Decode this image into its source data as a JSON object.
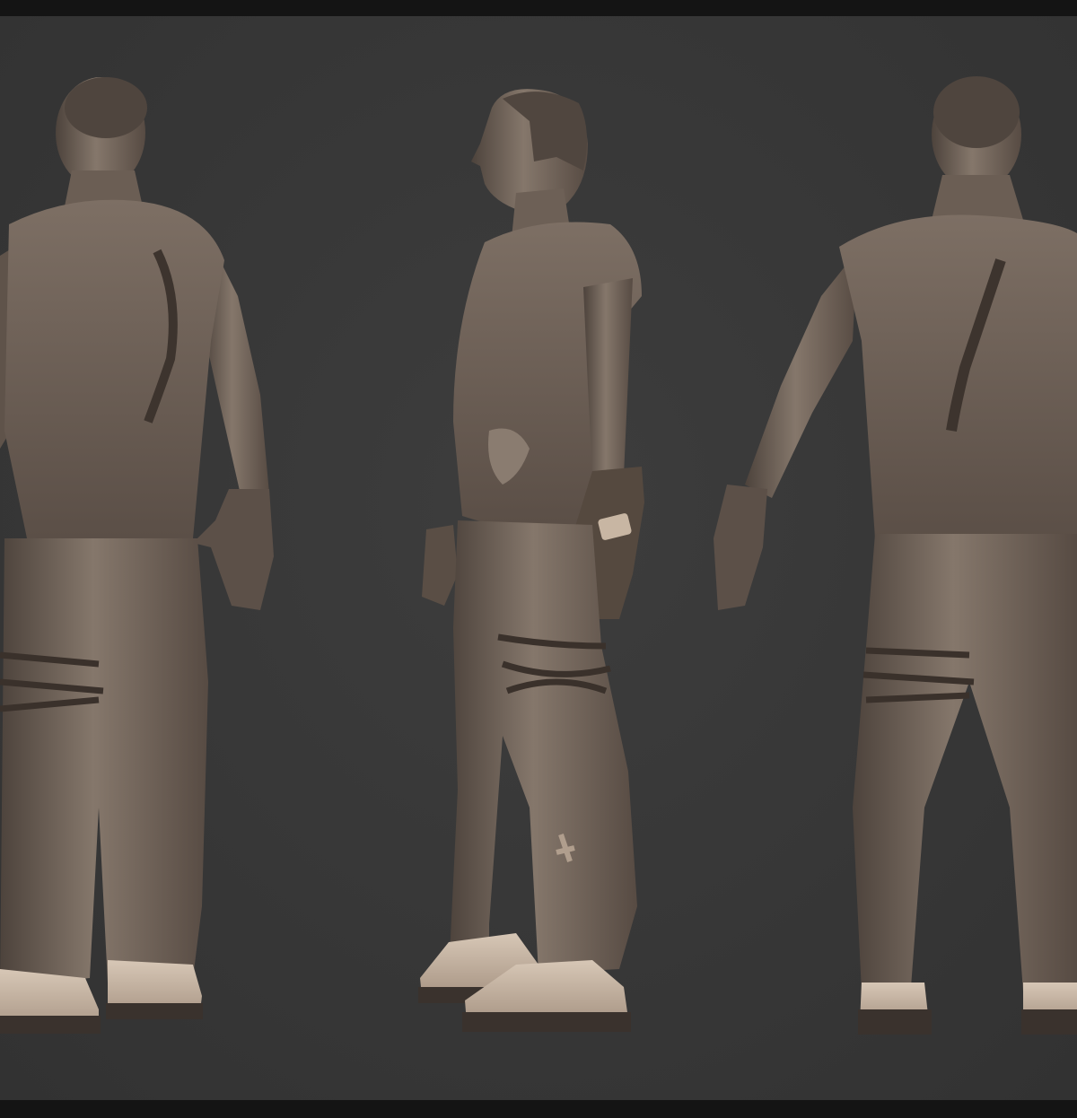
{
  "scene": {
    "views": [
      {
        "id": "back-three-quarter",
        "label": ""
      },
      {
        "id": "side-profile",
        "label": ""
      },
      {
        "id": "back",
        "label": ""
      }
    ]
  },
  "colors": {
    "background": "#383838",
    "bars": "#141414",
    "clay_light": "#8c7d70",
    "clay_mid": "#6e6157",
    "clay_dark": "#4a4039",
    "clay_shadow": "#2e2824",
    "boot_light": "#c9b9a8",
    "boot_sole": "#3a322d"
  }
}
